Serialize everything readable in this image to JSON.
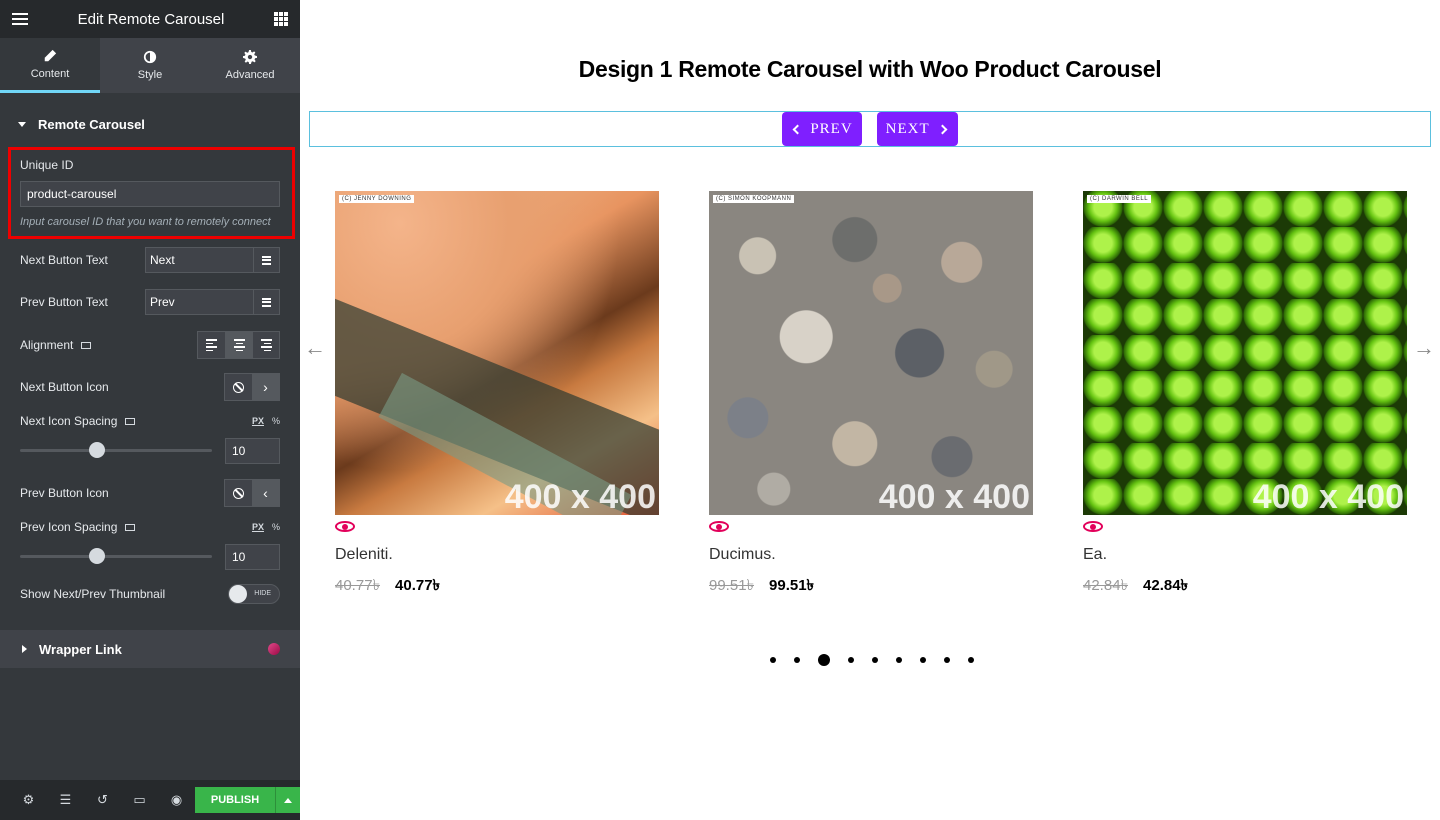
{
  "panel": {
    "title": "Edit Remote Carousel",
    "tabs": [
      {
        "label": "Content",
        "icon": "pencil-icon"
      },
      {
        "label": "Style",
        "icon": "contrast-icon"
      },
      {
        "label": "Advanced",
        "icon": "gear-icon"
      }
    ],
    "section_title": "Remote Carousel",
    "unique_id": {
      "label": "Unique ID",
      "value": "product-carousel",
      "hint": "Input carousel ID that you want to remotely connect"
    },
    "next_button_text": {
      "label": "Next Button Text",
      "value": "Next"
    },
    "prev_button_text": {
      "label": "Prev Button Text",
      "value": "Prev"
    },
    "alignment": {
      "label": "Alignment",
      "selected": "center"
    },
    "next_button_icon": {
      "label": "Next Button Icon"
    },
    "next_icon_spacing": {
      "label": "Next Icon Spacing",
      "unit_px": "PX",
      "unit_pct": "%",
      "value": "10",
      "slider_value": 10
    },
    "prev_button_icon": {
      "label": "Prev Button Icon"
    },
    "prev_icon_spacing": {
      "label": "Prev Icon Spacing",
      "unit_px": "PX",
      "unit_pct": "%",
      "value": "10",
      "slider_value": 10
    },
    "show_thumbnail": {
      "label": "Show Next/Prev Thumbnail",
      "toggle_text": "HIDE"
    },
    "wrapper_link": "Wrapper Link",
    "footer": {
      "publish": "PUBLISH"
    }
  },
  "preview": {
    "heading": "Design 1 Remote Carousel with Woo Product Carousel",
    "prev_label": "PREV",
    "next_label": "NEXT",
    "products": [
      {
        "credit": "(C) JENNY DOWNING",
        "dim": "400 x 400",
        "name": "Deleniti.",
        "old_price": "40.77৳",
        "price": "40.77৳"
      },
      {
        "credit": "(C) SIMON KOOPMANN",
        "dim": "400 x 400",
        "name": "Ducimus.",
        "old_price": "99.51৳",
        "price": "99.51৳"
      },
      {
        "credit": "(C) DARWIN BELL",
        "dim": "400 x 400",
        "name": "Ea.",
        "old_price": "42.84৳",
        "price": "42.84৳"
      }
    ],
    "pagination": {
      "total": 9,
      "active": 3
    }
  },
  "colors": {
    "accent": "#7f1fff",
    "publish": "#39b54a",
    "highlight_border": "#ee0000",
    "eye": "#e2005a"
  }
}
